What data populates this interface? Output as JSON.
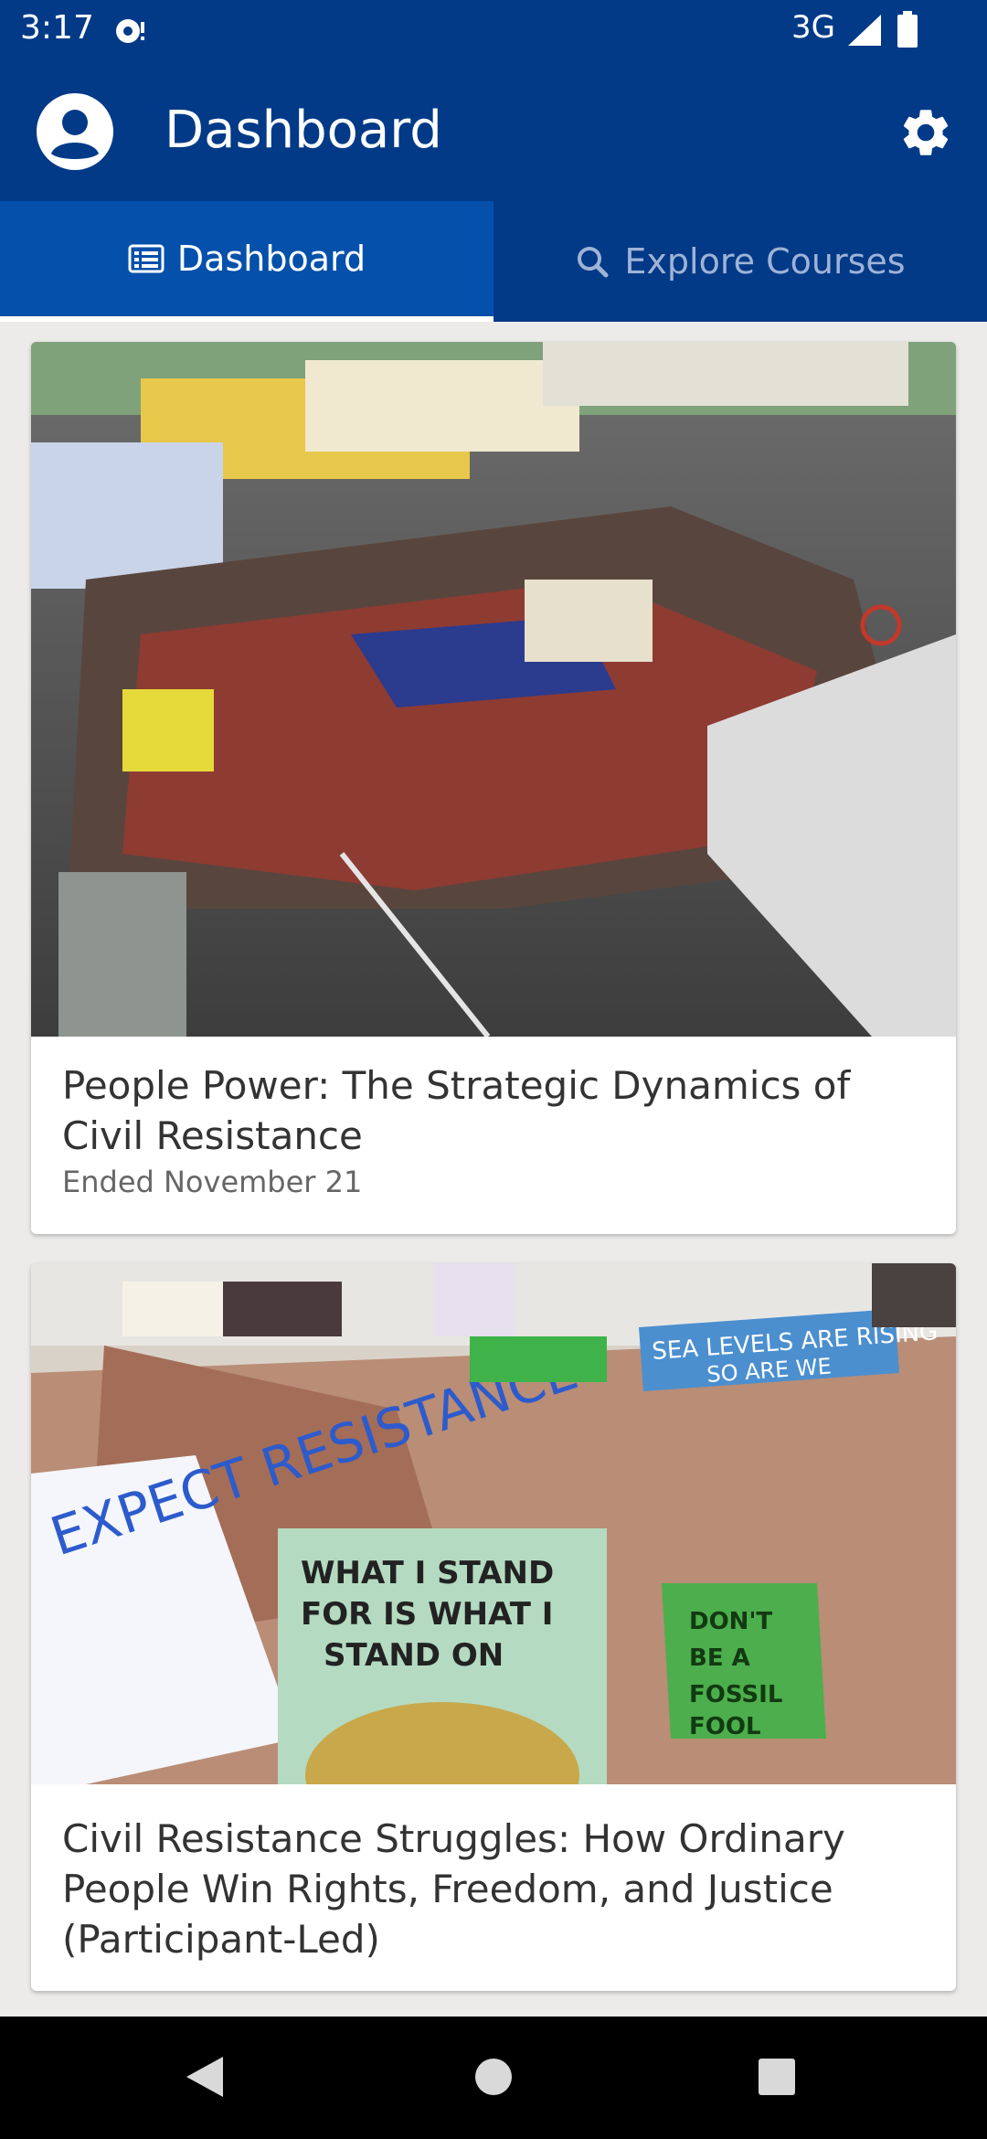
{
  "status_bar": {
    "time": "3:17",
    "network": "3G",
    "icons": [
      "notification-icon",
      "signal-icon",
      "battery-icon"
    ]
  },
  "app_bar": {
    "title": "Dashboard",
    "icons": [
      "account-avatar-icon",
      "settings-gear-icon"
    ]
  },
  "tabs": [
    {
      "label": "Dashboard",
      "icon": "list-icon",
      "active": true
    },
    {
      "label": "Explore Courses",
      "icon": "search-icon",
      "active": false
    }
  ],
  "courses": [
    {
      "title": "People Power: The Strategic Dynamics of Civil Resistance",
      "status": "Ended November 21",
      "image": "protest-march-photo"
    },
    {
      "title": "Civil Resistance Struggles: How Ordinary People Win Rights, Freedom, and Justice (Participant-Led)",
      "image": "climate-protest-photo",
      "sign_texts": [
        "WHAT I STAND FOR IS WHAT I STAND ON",
        "SEA LEVELS ARE RISING SO ARE WE",
        "DON'T BE A FOSSIL FOOL",
        "EXPECT RESISTANCE"
      ]
    }
  ],
  "colors": {
    "primary": "#023a87",
    "tab_active": "#0450ab",
    "background": "#ecebea"
  },
  "nav_icons": [
    "back-icon",
    "home-icon",
    "recents-icon"
  ]
}
